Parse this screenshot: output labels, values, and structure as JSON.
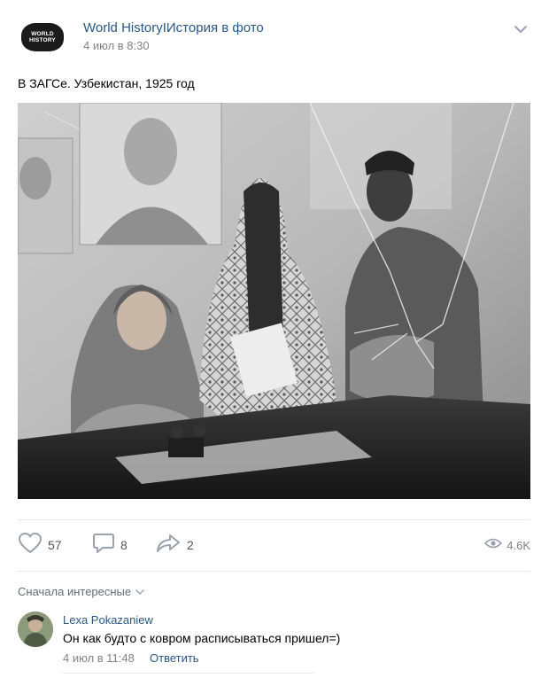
{
  "post": {
    "author": "World HistoryIИстория в фото",
    "date": "4 июл в 8:30",
    "avatar_text_line1": "WORLD",
    "avatar_text_line2": "HISTORY",
    "text": "В ЗАГСе. Узбекистан, 1925 год",
    "photo_icon": "historical-photo"
  },
  "actions": {
    "likes": "57",
    "comments": "8",
    "shares": "2",
    "views": "4.6K",
    "like_icon": "heart-icon",
    "comment_icon": "comment-icon",
    "share_icon": "share-icon",
    "views_icon": "eye-icon"
  },
  "comments": {
    "sort_label": "Сначала интересные",
    "items": [
      {
        "author": "Lexa Pokazaniew",
        "text": "Он как будто с ковром расписываться пришел=)",
        "date": "4 июл в 11:48",
        "reply_label": "Ответить"
      }
    ]
  },
  "colors": {
    "link": "#2a5885",
    "meta": "#828282",
    "icon": "#99a2ad",
    "divider": "#e7e8ec"
  }
}
